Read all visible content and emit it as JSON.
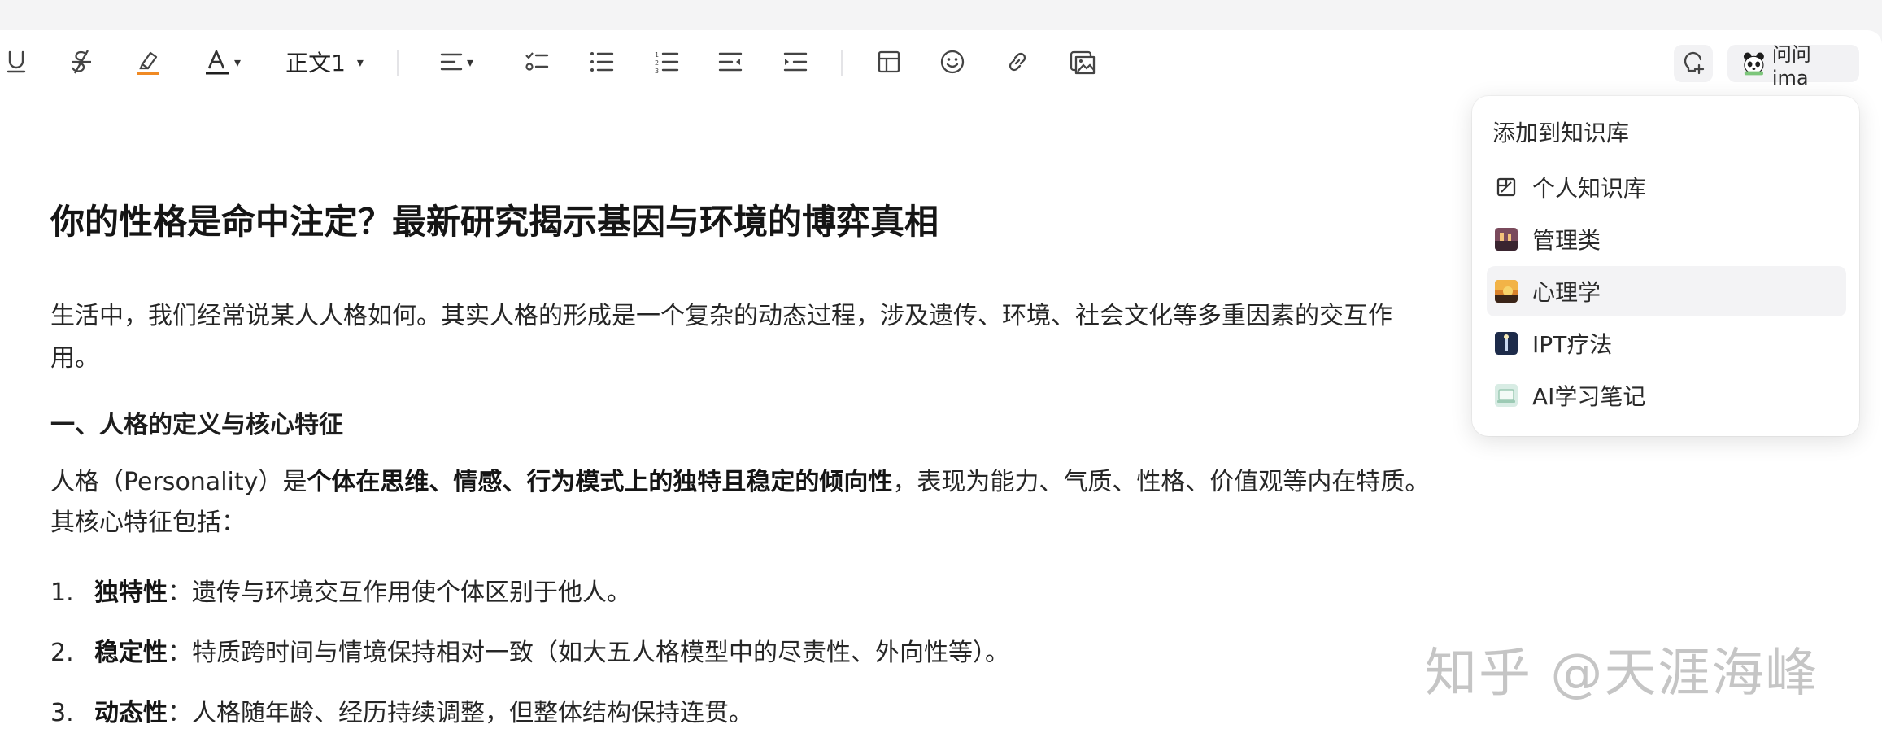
{
  "toolbar": {
    "text_style": "正文1",
    "ask_label": "问问ima",
    "highlight_color": "#f08a24",
    "font_color_underline": "#1f1f1f"
  },
  "document": {
    "title": "你的性格是命中注定？最新研究揭示基因与环境的博弈真相",
    "intro_line1": "生活中，我们经常说某人人格如何。其实人格的形成是一个复杂的动态过程，涉及遗传、环境、社会文化等多重因素的交互作",
    "intro_line2": "用。",
    "section1_heading": "一、人格的定义与核心特征",
    "def_prefix": "人格（Personality）是",
    "def_bold": "个体在思维、情感、行为模式上的独特且稳定的倾向性",
    "def_suffix": "，表现为能力、气质、性格、价值观等内在特质。",
    "def_line2": "其核心特征包括：",
    "list": [
      {
        "num": "1.",
        "term": "独特性",
        "desc": "：遗传与环境交互作用使个体区别于他人。"
      },
      {
        "num": "2.",
        "term": "稳定性",
        "desc": "：特质跨时间与情境保持相对一致（如大五人格模型中的尽责性、外向性等）。"
      },
      {
        "num": "3.",
        "term": "动态性",
        "desc": "：人格随年龄、经历持续调整，但整体结构保持连贯。"
      }
    ]
  },
  "knowledge_menu": {
    "title": "添加到知识库",
    "items": [
      {
        "label": "个人知识库",
        "icon": "personal-kb-icon"
      },
      {
        "label": "管理类",
        "icon": "management-thumb-icon",
        "color": "#7a4a5c"
      },
      {
        "label": "心理学",
        "icon": "psychology-thumb-icon",
        "color": "#d9822b"
      },
      {
        "label": "IPT疗法",
        "icon": "ipt-thumb-icon",
        "color": "#1d2b4a"
      },
      {
        "label": "AI学习笔记",
        "icon": "ai-notes-thumb-icon",
        "color": "#d8ece4"
      }
    ],
    "hovered_item": "心理学"
  },
  "watermark": "知乎 @天涯海峰"
}
